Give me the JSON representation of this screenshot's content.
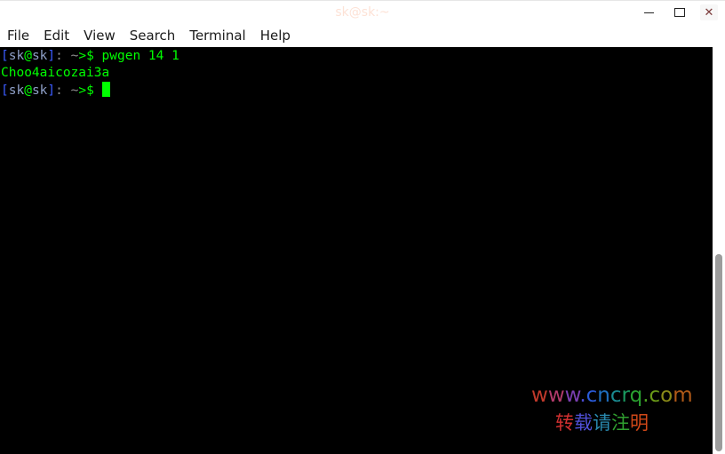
{
  "window": {
    "title": "sk@sk:~",
    "controls": {
      "minimize": "minimize",
      "maximize": "maximize",
      "close": "close"
    }
  },
  "menubar": {
    "items": [
      "File",
      "Edit",
      "View",
      "Search",
      "Terminal",
      "Help"
    ]
  },
  "terminal": {
    "prompt": {
      "open_bracket": "[",
      "user": "sk",
      "at": "@",
      "host": "sk",
      "close_bracket": "]",
      "colon": ":",
      "space": " ",
      "tilde": "~",
      "symbol": ">$"
    },
    "lines": [
      {
        "type": "command",
        "command": "pwgen 14 1"
      },
      {
        "type": "output",
        "text": "Choo4aicozai3a"
      },
      {
        "type": "prompt",
        "command": ""
      }
    ]
  },
  "watermark": {
    "url_chars": [
      {
        "c": "w",
        "color": "#c0392b"
      },
      {
        "c": "w",
        "color": "#b03a6a"
      },
      {
        "c": "w",
        "color": "#7a3fb0"
      },
      {
        "c": ".",
        "color": "#4a4ad0"
      },
      {
        "c": "c",
        "color": "#2a5ad8"
      },
      {
        "c": "n",
        "color": "#1f6fc0"
      },
      {
        "c": "c",
        "color": "#1a8a90"
      },
      {
        "c": "r",
        "color": "#1a9a60"
      },
      {
        "c": "q",
        "color": "#2aa030"
      },
      {
        "c": ".",
        "color": "#4aa020"
      },
      {
        "c": "c",
        "color": "#6a9a18"
      },
      {
        "c": "o",
        "color": "#8a8a18"
      },
      {
        "c": "m",
        "color": "#b05a18"
      }
    ],
    "cn_chars": [
      {
        "c": "转",
        "color": "#d03030"
      },
      {
        "c": "载",
        "color": "#5050d8"
      },
      {
        "c": "请",
        "color": "#2a8ab0"
      },
      {
        "c": "注",
        "color": "#30a030"
      },
      {
        "c": "明",
        "color": "#d04818"
      }
    ]
  },
  "colors": {
    "terminal_bg": "#000000",
    "terminal_fg": "#00ff00",
    "bracket": "#3b5bff",
    "user": "#8fa0c8",
    "separator": "#8e8e8e"
  }
}
